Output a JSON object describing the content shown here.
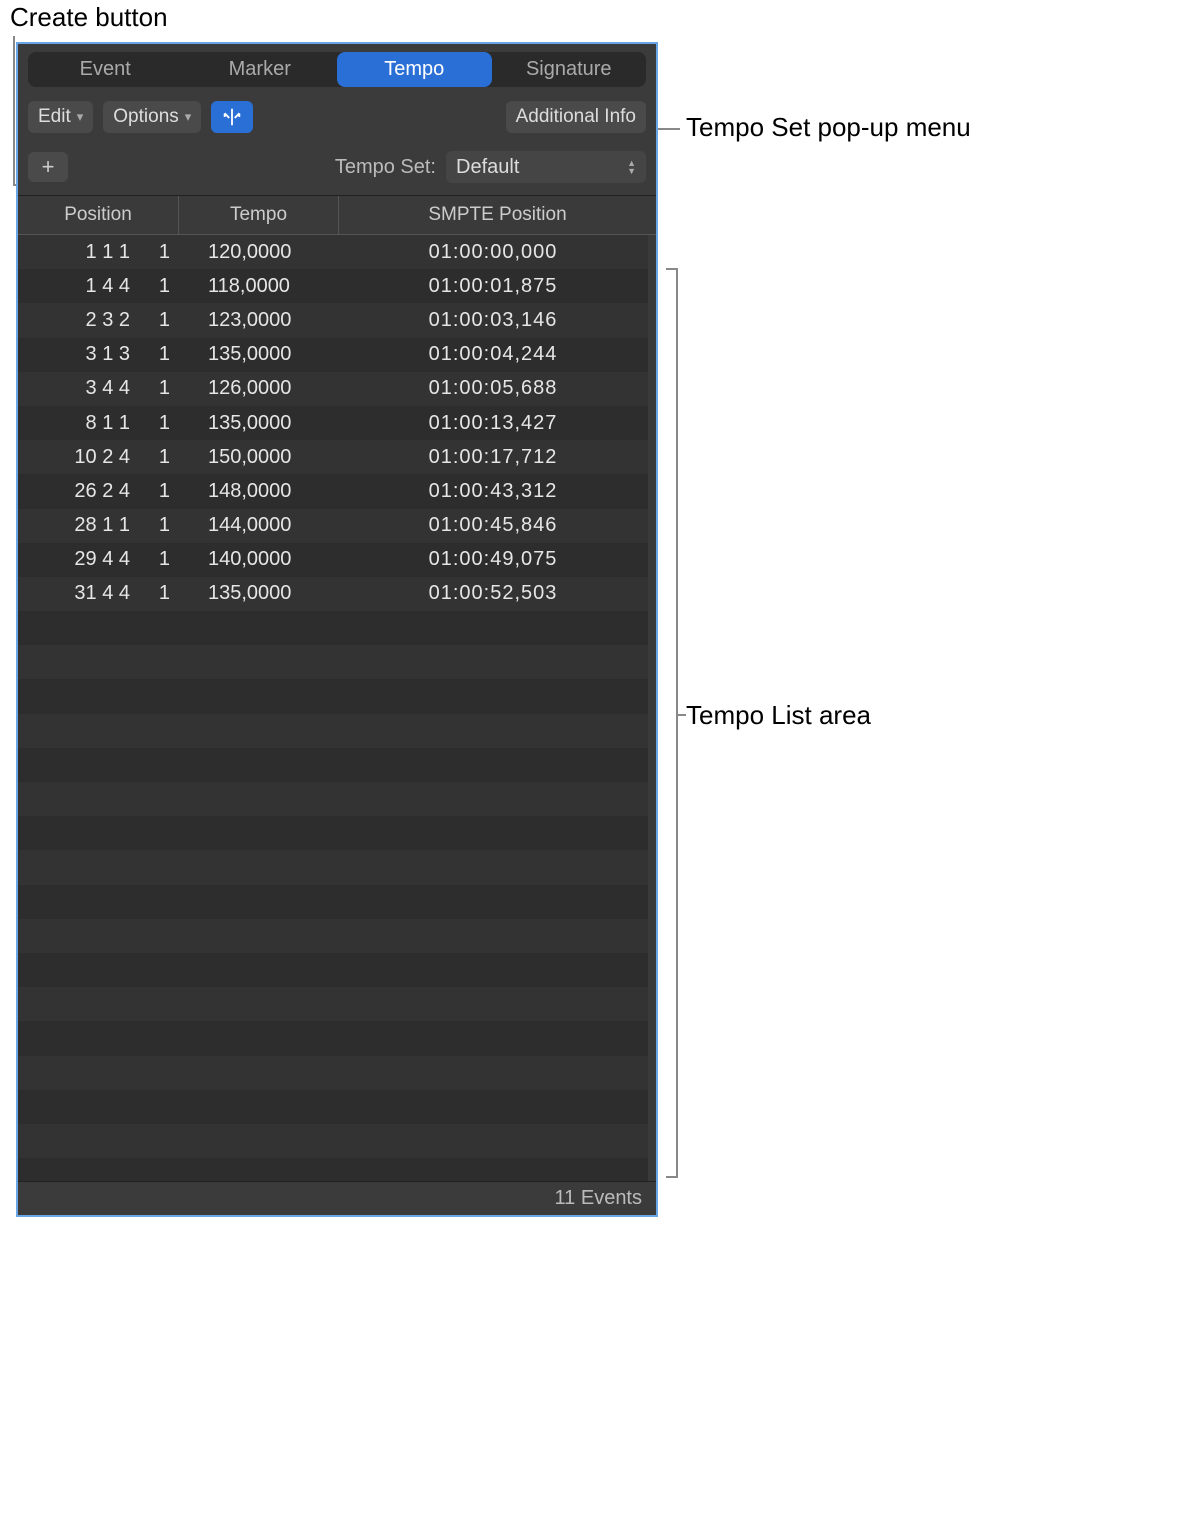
{
  "callouts": {
    "create_button": "Create button",
    "tempo_set_menu": "Tempo Set pop-up menu",
    "tempo_list_area": "Tempo List area"
  },
  "tabs": {
    "event": "Event",
    "marker": "Marker",
    "tempo": "Tempo",
    "signature": "Signature",
    "active": "tempo"
  },
  "toolbar": {
    "edit": "Edit",
    "options": "Options",
    "additional_info": "Additional Info"
  },
  "tempo_set": {
    "label": "Tempo Set:",
    "value": "Default"
  },
  "columns": {
    "position": "Position",
    "tempo": "Tempo",
    "smpte": "SMPTE Position"
  },
  "rows": [
    {
      "pos": "1 1 1",
      "sub": "1",
      "tempo": "120,0000",
      "smpte": "01:00:00,000"
    },
    {
      "pos": "1 4 4",
      "sub": "1",
      "tempo": "118,0000",
      "smpte": "01:00:01,875"
    },
    {
      "pos": "2 3 2",
      "sub": "1",
      "tempo": "123,0000",
      "smpte": "01:00:03,146"
    },
    {
      "pos": "3 1 3",
      "sub": "1",
      "tempo": "135,0000",
      "smpte": "01:00:04,244"
    },
    {
      "pos": "3 4 4",
      "sub": "1",
      "tempo": "126,0000",
      "smpte": "01:00:05,688"
    },
    {
      "pos": "8 1 1",
      "sub": "1",
      "tempo": "135,0000",
      "smpte": "01:00:13,427"
    },
    {
      "pos": "10 2 4",
      "sub": "1",
      "tempo": "150,0000",
      "smpte": "01:00:17,712"
    },
    {
      "pos": "26 2 4",
      "sub": "1",
      "tempo": "148,0000",
      "smpte": "01:00:43,312"
    },
    {
      "pos": "28 1 1",
      "sub": "1",
      "tempo": "144,0000",
      "smpte": "01:00:45,846"
    },
    {
      "pos": "29 4 4",
      "sub": "1",
      "tempo": "140,0000",
      "smpte": "01:00:49,075"
    },
    {
      "pos": "31 4 4",
      "sub": "1",
      "tempo": "135,0000",
      "smpte": "01:00:52,503"
    }
  ],
  "empty_row_count": 21,
  "footer": {
    "events": "11 Events"
  },
  "icons": {
    "plus": "+"
  }
}
